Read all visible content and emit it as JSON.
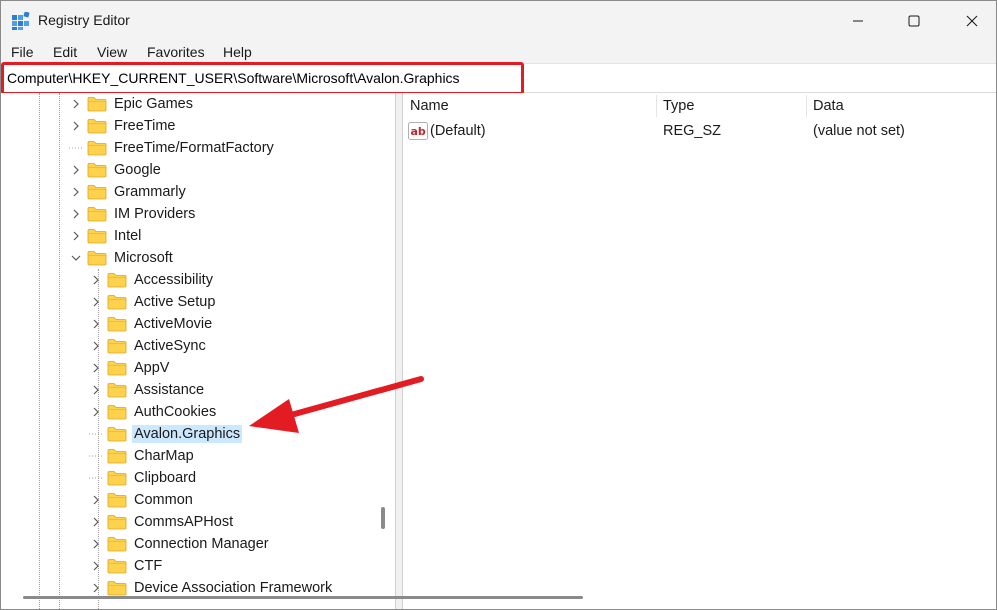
{
  "window": {
    "title": "Registry Editor"
  },
  "menu": [
    "File",
    "Edit",
    "View",
    "Favorites",
    "Help"
  ],
  "address": {
    "path": "Computer\\HKEY_CURRENT_USER\\Software\\Microsoft\\Avalon.Graphics"
  },
  "tree": {
    "items": [
      {
        "label": "Epic Games",
        "level": 1,
        "expand": "collapsed"
      },
      {
        "label": "FreeTime",
        "level": 1,
        "expand": "collapsed"
      },
      {
        "label": "FreeTime/FormatFactory",
        "level": 1,
        "expand": "none"
      },
      {
        "label": "Google",
        "level": 1,
        "expand": "collapsed"
      },
      {
        "label": "Grammarly",
        "level": 1,
        "expand": "collapsed"
      },
      {
        "label": "IM Providers",
        "level": 1,
        "expand": "collapsed"
      },
      {
        "label": "Intel",
        "level": 1,
        "expand": "collapsed"
      },
      {
        "label": "Microsoft",
        "level": 1,
        "expand": "expanded"
      },
      {
        "label": "Accessibility",
        "level": 2,
        "expand": "collapsed"
      },
      {
        "label": "Active Setup",
        "level": 2,
        "expand": "collapsed"
      },
      {
        "label": "ActiveMovie",
        "level": 2,
        "expand": "collapsed"
      },
      {
        "label": "ActiveSync",
        "level": 2,
        "expand": "collapsed"
      },
      {
        "label": "AppV",
        "level": 2,
        "expand": "collapsed"
      },
      {
        "label": "Assistance",
        "level": 2,
        "expand": "collapsed"
      },
      {
        "label": "AuthCookies",
        "level": 2,
        "expand": "collapsed"
      },
      {
        "label": "Avalon.Graphics",
        "level": 2,
        "expand": "none",
        "selected": true
      },
      {
        "label": "CharMap",
        "level": 2,
        "expand": "none"
      },
      {
        "label": "Clipboard",
        "level": 2,
        "expand": "none"
      },
      {
        "label": "Common",
        "level": 2,
        "expand": "collapsed"
      },
      {
        "label": "CommsAPHost",
        "level": 2,
        "expand": "collapsed"
      },
      {
        "label": "Connection Manager",
        "level": 2,
        "expand": "collapsed"
      },
      {
        "label": "CTF",
        "level": 2,
        "expand": "collapsed"
      },
      {
        "label": "Device Association Framework",
        "level": 2,
        "expand": "collapsed"
      }
    ]
  },
  "list": {
    "columns": [
      "Name",
      "Type",
      "Data"
    ],
    "rows": [
      {
        "name": "(Default)",
        "type": "REG_SZ",
        "data": "(value not set)",
        "icon": "string-value-icon"
      }
    ]
  },
  "colors": {
    "highlight": "#e31b23",
    "selection": "#cce8ff",
    "folder": "#ffd24d"
  }
}
